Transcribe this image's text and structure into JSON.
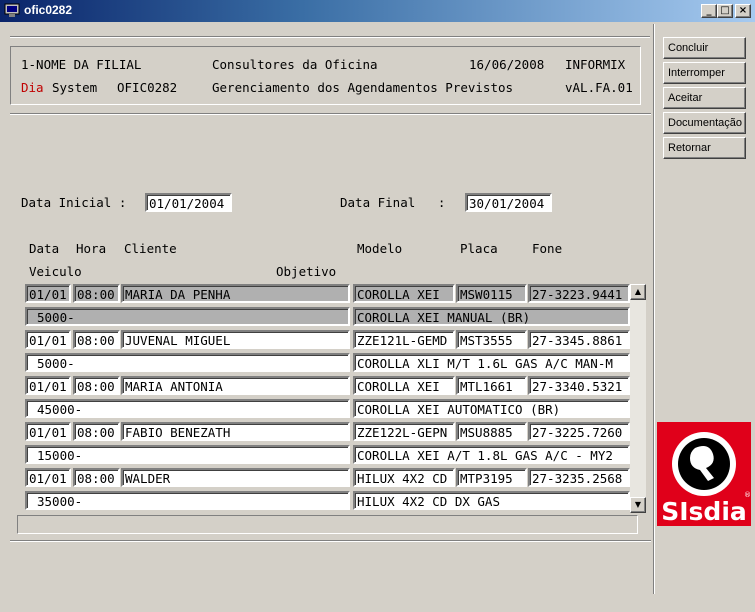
{
  "window": {
    "title": "ofic0282"
  },
  "header": {
    "filial": "1-NOME DA FILIAL",
    "title": "Consultores da Oficina",
    "date": "16/06/2008",
    "db": "INFORMIX",
    "dia": "Dia",
    "system": "System",
    "program": "OFIC0282",
    "subtitle": "Gerenciamento dos Agendamentos Previstos",
    "version": "vAL.FA.01"
  },
  "sidebar": {
    "buttons": [
      "Concluir",
      "Interromper",
      "Aceitar",
      "Documentação",
      "Retornar"
    ]
  },
  "filters": {
    "start_label": "Data Inicial :",
    "start_value": "01/01/2004",
    "end_label": "Data Final   :",
    "end_value": "30/01/2004"
  },
  "columns": {
    "data": "Data",
    "hora": "Hora",
    "cliente": "Cliente",
    "modelo": "Modelo",
    "placa": "Placa",
    "fone": "Fone",
    "veiculo": "Veiculo",
    "objetivo": "Objetivo"
  },
  "rows": [
    {
      "data": "01/01",
      "hora": "08:00",
      "cliente": "MARIA DA PENHA",
      "modelo": "COROLLA XEI",
      "placa": "MSW0115",
      "fone": "27-3223.9441",
      "veiculo": "5000-",
      "descricao": "COROLLA XEI MANUAL (BR)"
    },
    {
      "data": "01/01",
      "hora": "08:00",
      "cliente": "JUVENAL MIGUEL",
      "modelo": "ZZE121L-GEMD",
      "placa": "MST3555",
      "fone": "27-3345.8861",
      "veiculo": "5000-",
      "descricao": "COROLLA XLI M/T 1.6L GAS A/C MAN-M"
    },
    {
      "data": "01/01",
      "hora": "08:00",
      "cliente": "MARIA ANTONIA",
      "modelo": "COROLLA XEI",
      "placa": "MTL1661",
      "fone": "27-3340.5321",
      "veiculo": "45000-",
      "descricao": "COROLLA XEI AUTOMATICO (BR)"
    },
    {
      "data": "01/01",
      "hora": "08:00",
      "cliente": "FABIO BENEZATH",
      "modelo": "ZZE122L-GEPN",
      "placa": "MSU8885",
      "fone": "27-3225.7260",
      "veiculo": "15000-",
      "descricao": "COROLLA XEI A/T 1.8L GAS A/C - MY2"
    },
    {
      "data": "01/01",
      "hora": "08:00",
      "cliente": "WALDER",
      "modelo": "HILUX 4X2 CD",
      "placa": "MTP3195",
      "fone": "27-3235.2568",
      "veiculo": "35000-",
      "descricao": "HILUX 4X2 CD DX GAS"
    }
  ],
  "logo": {
    "text": "SIsdia"
  },
  "colors": {
    "titlebar": "#0a246a",
    "logo": "#e0001a",
    "selected_row": "#b0b0b0",
    "dia_label": "#c00000"
  }
}
